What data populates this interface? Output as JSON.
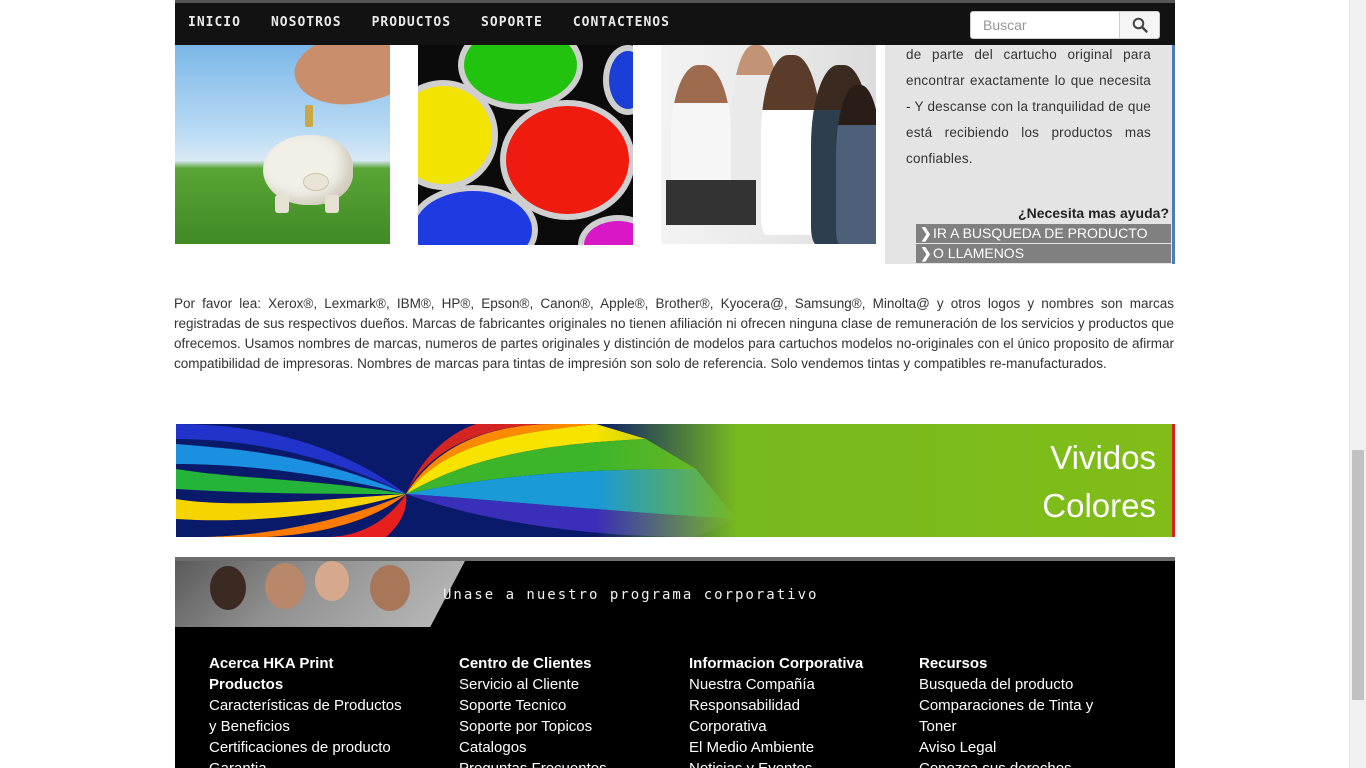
{
  "nav": {
    "items": [
      "INICIO",
      "NOSOTROS",
      "PRODUCTOS",
      "SOPORTE",
      "CONTACTENOS"
    ],
    "search_placeholder": "Buscar"
  },
  "info_panel": {
    "text": "de parte del cartucho original para encontrar exactamente lo que necesita - Y descanse con la tranquilidad de que está recibiendo los productos mas confiables.",
    "help_title": "¿Necesita mas ayuda?",
    "links": [
      "IR A BUSQUEDA DE PRODUCTO",
      "O LLAMENOS"
    ]
  },
  "disclaimer": "Por favor lea: Xerox®, Lexmark®, IBM®, HP®, Epson®, Canon®, Apple®, Brother®, Kyocera@, Samsung®, Minolta@ y otros logos y nombres son marcas registradas de sus respectivos dueños. Marcas de fabricantes originales no tienen afiliación ni ofrecen ninguna clase de remuneración de los servicios y productos que ofrecemos. Usamos nombres de marcas, numeros de partes originales y distinción de modelos para cartuchos modelos no-originales con el único proposito de afirmar compatibilidad de impresoras. Nombres de marcas para tintas de impresión son solo de referencia. Solo vendemos tintas y compatibles re-manufacturados.",
  "banner": {
    "line1": "Vividos",
    "line2": "Colores"
  },
  "footer": {
    "corp_text": "Unase a nuestro programa corporativo",
    "columns": [
      {
        "title": "Acerca HKA Print",
        "links": [
          "Productos",
          "Características de Productos",
          "y Beneficios",
          "Certificaciones de producto",
          "Garantia"
        ],
        "bold_first": true
      },
      {
        "title": "Centro de Clientes",
        "links": [
          "Servicio al Cliente",
          "Soporte Tecnico",
          "Soporte por Topicos",
          "Catalogos",
          "Preguntas Frecuentes"
        ]
      },
      {
        "title": "Informacion Corporativa",
        "links": [
          "Nuestra Compañía",
          "Responsabilidad",
          "Corporativa",
          "El Medio Ambiente",
          "Noticias y Eventos"
        ]
      },
      {
        "title": "Recursos",
        "links": [
          "Busqueda del producto",
          "Comparaciones de Tinta y",
          "Toner",
          "Aviso Legal",
          "Conozca sus derechos"
        ]
      }
    ]
  },
  "colors": {
    "nav_bg": "#121212",
    "panel_bg": "#e4e4e4",
    "panel_accent": "#4c7cbc",
    "banner_green": "#77b821",
    "banner_accent": "#e02020"
  }
}
